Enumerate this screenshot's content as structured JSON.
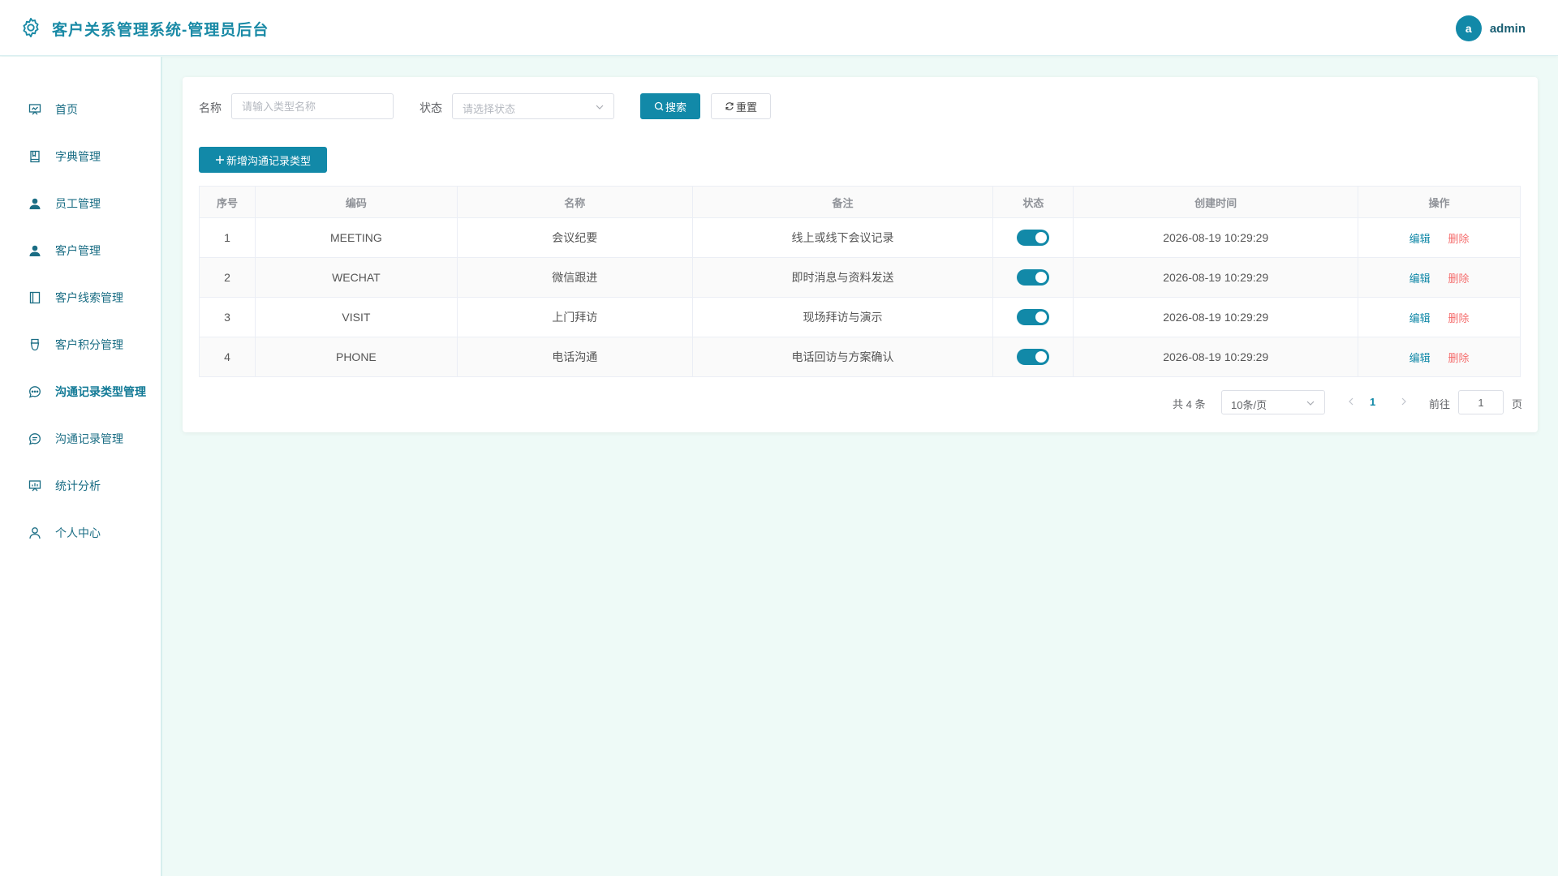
{
  "header": {
    "title": "客户关系管理系统-管理员后台",
    "avatar_letter": "a",
    "username": "admin"
  },
  "sidebar": {
    "items": [
      {
        "label": "首页",
        "icon": "presentation-icon"
      },
      {
        "label": "字典管理",
        "icon": "book-icon"
      },
      {
        "label": "员工管理",
        "icon": "user-filled-icon"
      },
      {
        "label": "客户管理",
        "icon": "user-filled-icon"
      },
      {
        "label": "客户线索管理",
        "icon": "notebook-icon"
      },
      {
        "label": "客户积分管理",
        "icon": "medal-icon"
      },
      {
        "label": "沟通记录类型管理",
        "icon": "chat-dots-icon",
        "active": true
      },
      {
        "label": "沟通记录管理",
        "icon": "chat-line-icon"
      },
      {
        "label": "统计分析",
        "icon": "data-board-icon"
      },
      {
        "label": "个人中心",
        "icon": "user-outline-icon"
      }
    ]
  },
  "filters": {
    "name_label": "名称",
    "name_placeholder": "请输入类型名称",
    "status_label": "状态",
    "status_placeholder": "请选择状态",
    "search_label": "搜索",
    "reset_label": "重置"
  },
  "add_button_label": "新增沟通记录类型",
  "table": {
    "headers": [
      "序号",
      "编码",
      "名称",
      "备注",
      "状态",
      "创建时间",
      "操作"
    ],
    "rows": [
      {
        "index": "1",
        "code": "MEETING",
        "name": "会议纪要",
        "remark": "线上或线下会议记录",
        "enabled": true,
        "created": "2026-08-19 10:29:29"
      },
      {
        "index": "2",
        "code": "WECHAT",
        "name": "微信跟进",
        "remark": "即时消息与资料发送",
        "enabled": true,
        "created": "2026-08-19 10:29:29"
      },
      {
        "index": "3",
        "code": "VISIT",
        "name": "上门拜访",
        "remark": "现场拜访与演示",
        "enabled": true,
        "created": "2026-08-19 10:29:29"
      },
      {
        "index": "4",
        "code": "PHONE",
        "name": "电话沟通",
        "remark": "电话回访与方案确认",
        "enabled": true,
        "created": "2026-08-19 10:29:29"
      }
    ],
    "edit_label": "编辑",
    "delete_label": "删除"
  },
  "pagination": {
    "total_text": "共 4 条",
    "page_size": "10条/页",
    "current_page": "1",
    "goto_label": "前往",
    "goto_value": "1",
    "page_suffix": "页"
  },
  "colors": {
    "primary": "#1289a8",
    "danger": "#f56c6c",
    "background": "#eefaf7"
  }
}
